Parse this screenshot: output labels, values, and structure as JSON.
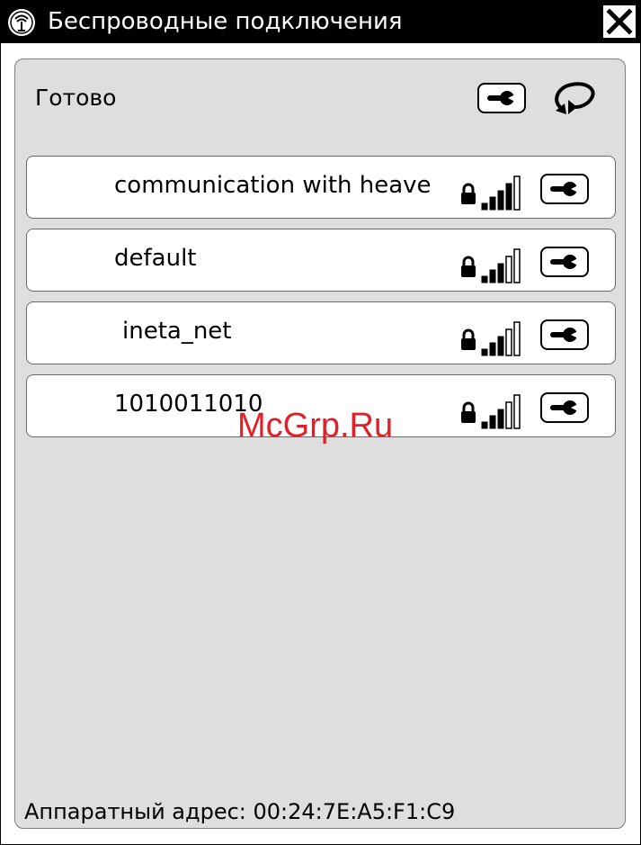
{
  "window": {
    "title": "Беспроводные подключения",
    "close_icon": "close-icon",
    "app_icon": "wireless-app-icon"
  },
  "status": {
    "text": "Готово",
    "settings_icon": "wrench-icon",
    "refresh_icon": "refresh-icon"
  },
  "networks": [
    {
      "name": "communication with heave",
      "secured": true,
      "signal_bars": 5,
      "signal_active": 4
    },
    {
      "name": "default",
      "secured": true,
      "signal_bars": 5,
      "signal_active": 3
    },
    {
      "name": "ineta_net",
      "secured": true,
      "signal_bars": 5,
      "signal_active": 3
    },
    {
      "name": "1010011010",
      "secured": true,
      "signal_bars": 5,
      "signal_active": 3
    }
  ],
  "footer": {
    "mac_label": "Аппаратный адрес: 00:24:7E:A5:F1:C9"
  },
  "watermark": "McGrp.Ru",
  "colors": {
    "titlebar": "#000000",
    "panel": "#dedede",
    "row": "#ffffff",
    "watermark": "#e21f26"
  }
}
